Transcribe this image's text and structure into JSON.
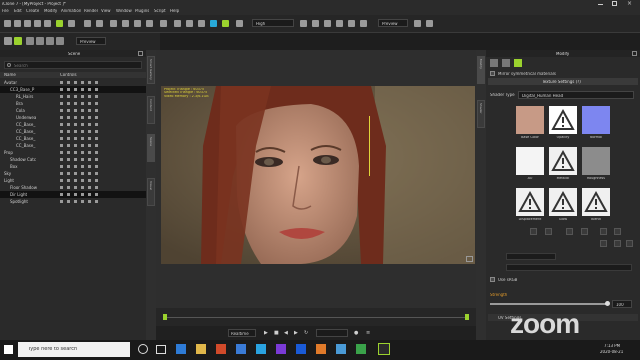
{
  "window": {
    "title": "iClone 7 - [MyProject - Project ]*"
  },
  "menu": [
    "File",
    "Edit",
    "Create",
    "Modify",
    "Animation",
    "Render",
    "View",
    "Window",
    "Plugins",
    "Script",
    "Help"
  ],
  "toolbar": {
    "quality": "High",
    "preview": "Preview",
    "camera": "Preview"
  },
  "scene": {
    "title": "Scene",
    "search_placeholder": "Search",
    "col_name": "Name",
    "col_controls": "Controls",
    "rows": [
      {
        "label": "Avatar",
        "indent": 0,
        "selected": false
      },
      {
        "label": "CC3_Base_P",
        "indent": 2,
        "selected": true
      },
      {
        "label": "RL_Hairs",
        "indent": 4,
        "selected": false
      },
      {
        "label": "Bra",
        "indent": 4,
        "selected": false
      },
      {
        "label": "Cola",
        "indent": 4,
        "selected": false
      },
      {
        "label": "Underwea",
        "indent": 4,
        "selected": false
      },
      {
        "label": "CC_Base_",
        "indent": 4,
        "selected": false
      },
      {
        "label": "CC_Base_",
        "indent": 4,
        "selected": false
      },
      {
        "label": "CC_Base_",
        "indent": 4,
        "selected": false
      },
      {
        "label": "CC_Base_",
        "indent": 4,
        "selected": false
      },
      {
        "label": "Prop",
        "indent": 0,
        "selected": false
      },
      {
        "label": "Shadow Catc",
        "indent": 2,
        "selected": false
      },
      {
        "label": "Box",
        "indent": 2,
        "selected": false
      },
      {
        "label": "Sky",
        "indent": 0,
        "selected": false
      },
      {
        "label": "Light",
        "indent": 0,
        "selected": false
      },
      {
        "label": "Floor Shadow",
        "indent": 2,
        "selected": false
      },
      {
        "label": "Dir Light",
        "indent": 2,
        "selected": true
      },
      {
        "label": "Spotlight",
        "indent": 2,
        "selected": false
      }
    ]
  },
  "left_tabs": [
    "Smart Gallery",
    "Content",
    "Scene",
    "Visual"
  ],
  "viewport": {
    "stats": [
      "Project Triangle : 60375",
      "Selected Triangle : 60375",
      "Video Memory : 2.3/6.1GB"
    ]
  },
  "timeline": {
    "realtime": "Realtime"
  },
  "modify": {
    "title": "Modify",
    "mirrored_label": "Mirror symmetrical materials",
    "texture_settings": "Texture Settings (?)",
    "shader_label": "Shader Type",
    "shader_value": "Digital_Human Head",
    "thumbs": [
      "Base Color",
      "Opacity",
      "Normal",
      "AO",
      "Metallic",
      "Roughness",
      "Displacement",
      "Glow",
      "Blend"
    ],
    "use_label": "Use sRGB",
    "strength_label": "Strength",
    "strength_value": "100",
    "section": "UV Settings"
  },
  "right_tabs": [
    "Modify",
    "Shader",
    "Visual"
  ],
  "taskbar": {
    "search": "Type here to search",
    "time": "7:13 PM",
    "date": "2020-08-21"
  },
  "overlay": {
    "zoom": "zoom"
  },
  "colors": {
    "accent_green": "#9bd22e",
    "accent_blue": "#28a9d8",
    "stats_yellow": "#e0d53a"
  }
}
